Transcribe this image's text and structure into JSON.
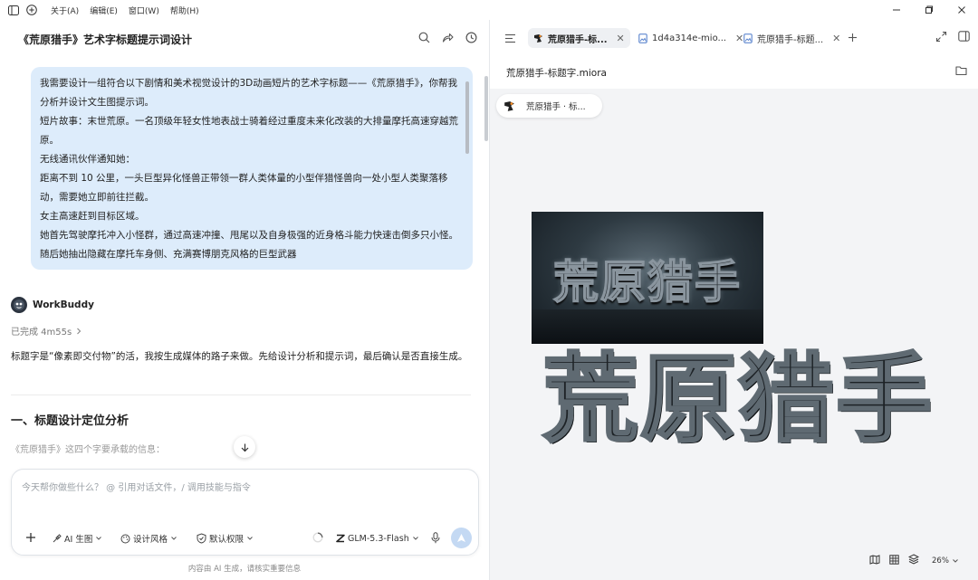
{
  "menubar": {
    "items": [
      "关于(A)",
      "编辑(E)",
      "窗口(W)",
      "帮助(H)"
    ]
  },
  "chat": {
    "title": "《荒原猎手》艺术字标题提示词设计",
    "user_message": {
      "lines": [
        "我需要设计一组符合以下剧情和美术视觉设计的3D动画短片的艺术字标题——《荒原猎手》，你帮我分析并设计文生图提示词。",
        "短片故事：末世荒原。一名顶级年轻女性地表战士骑着经过重度未来化改装的大排量摩托高速穿越荒原。",
        "无线通讯伙伴通知她：",
        "距离不到 10 公里，一头巨型异化怪兽正带领一群人类体量的小型伴猎怪兽向一处小型人类聚落移动，需要她立即前往拦截。",
        "女主高速赶到目标区域。",
        "她首先驾驶摩托冲入小怪群，通过高速冲撞、甩尾以及自身极强的近身格斗能力快速击倒多只小怪。",
        "随后她抽出隐藏在摩托车身侧、充满赛博朋克风格的巨型武器"
      ]
    },
    "agent": {
      "name": "WorkBuddy",
      "status": "已完成 4m55s",
      "answer": "标题字是“像素即交付物”的活，我按生成媒体的路子来做。先给设计分析和提示词，最后确认是否直接生成。",
      "section_title": "一、标题设计定位分析",
      "section_sub": "《荒原猎手》这四个字要承载的信息："
    },
    "composer": {
      "placeholder": "今天帮你做些什么？ @ 引用对话文件，/ 调用技能与指令",
      "tools": {
        "ai_image": "AI 生图",
        "style": "设计风格",
        "permission": "默认权限",
        "model": "GLM-5.3-Flash"
      }
    },
    "footer_note": "内容由 AI 生成，请核实重要信息"
  },
  "viewer": {
    "tabs": [
      {
        "label": "荒原猎手-标...",
        "active": true
      },
      {
        "label": "1d4a314e-mio...",
        "active": false
      },
      {
        "label": "荒原猎手-标题...",
        "active": false
      }
    ],
    "file_path": "荒原猎手-标题字.miora",
    "chip_label": "荒原猎手 · 标...",
    "artwork_title": "荒原猎手",
    "zoom": "26%"
  },
  "colors": {
    "accent": "#1a73e8",
    "bubble": "#ddecfb",
    "send_button": "#c4d9f3"
  }
}
